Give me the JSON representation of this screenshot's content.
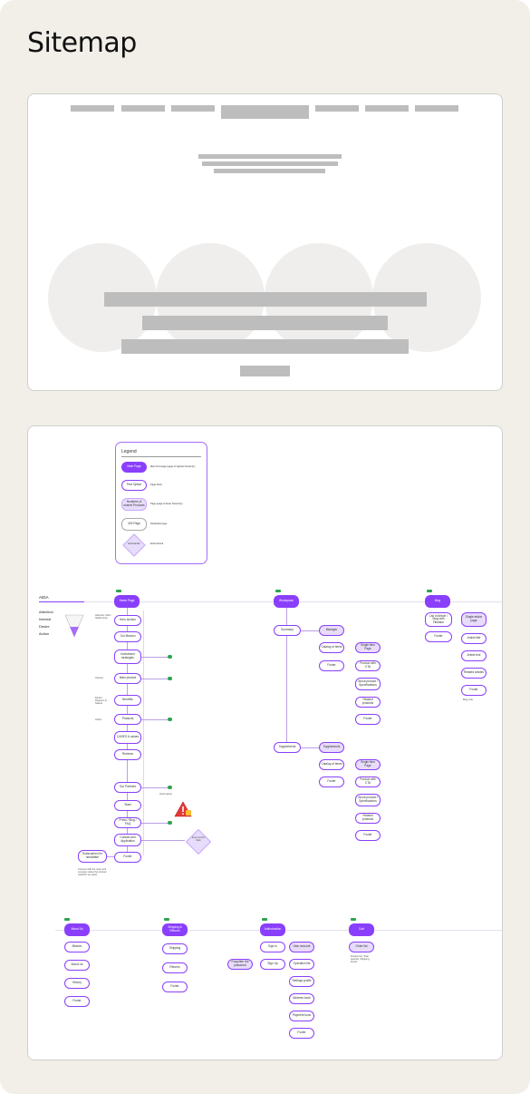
{
  "page_title": "Sitemap",
  "legend": {
    "title": "Legend",
    "items": [
      {
        "shape": "Main Page",
        "desc": "Main first-stage (page of highest hierarchy)"
      },
      {
        "shape": "First Option",
        "desc": "Page block"
      },
      {
        "shape": "Numbers of shared Products",
        "desc": "Page (page of lower hierarchy)"
      },
      {
        "shape": "404 Page",
        "desc": "Dedicated page"
      },
      {
        "shape": "External link",
        "desc": "External link"
      }
    ]
  },
  "aida": {
    "title": "AIDA",
    "stages": [
      "Attention",
      "Interest",
      "Desire",
      "Action"
    ]
  },
  "home": {
    "main": "Home Page",
    "notes": [
      "Attention: Main hidden links",
      "Interest",
      "Desire: Reasons to believe",
      "Action"
    ],
    "items": [
      "Hero section",
      "Our Mission",
      "Investment strategies",
      "Main product",
      "Benefits",
      "Products",
      "CASES & values",
      "Reviews",
      "Our Partners",
      "Team",
      "Press / Blog / FAQ",
      "Contact and Application",
      "Footer"
    ],
    "side_note": "Subscription for newsletter",
    "info_note": "Information",
    "external": "External link Main",
    "small_note": "Connect with the news and company about the product (whether we want)"
  },
  "workspace": {
    "main": "Workspace",
    "groups": [
      {
        "left": "Summary",
        "sub": "Manager",
        "items": [
          "Catalog of items",
          "Footer"
        ],
        "single": "Single item Page",
        "right": [
          "Product with CTA",
          "About product / Specifications",
          "Related products",
          "Footer"
        ]
      },
      {
        "left": "Supplements",
        "sub": "Supplements",
        "items": [
          "Catalog of items",
          "Footer"
        ],
        "single": "Single item Page",
        "right": [
          "Product with CTA",
          "About product / Specifications",
          "Related products",
          "Footer"
        ]
      }
    ]
  },
  "blog": {
    "main": "Blog",
    "items": [
      "List of Article / Blog with Filtration",
      "Footer"
    ],
    "single": "Single article page",
    "right": [
      "Article title",
      "Article text",
      "Related articles",
      "Footer"
    ],
    "note": "Blog note"
  },
  "about": {
    "main": "About Us",
    "items": [
      "Mission",
      "About Us",
      "History",
      "Footer"
    ]
  },
  "shipping": {
    "main": "Shipping & Returns",
    "items": [
      "Shipping",
      "Returns",
      "Footer"
    ]
  },
  "auth": {
    "main": "Authorization",
    "left": "Forgotten the password",
    "items": [
      "Sign In",
      "Sign Up"
    ],
    "right": [
      "User account",
      "Operation list",
      "Settings profile",
      "Address book",
      "Payment book",
      "Footer"
    ]
  },
  "cart": {
    "main": "Cart",
    "item": "Order list",
    "note": "Product list: Total quantity, Shipping, Footer"
  }
}
